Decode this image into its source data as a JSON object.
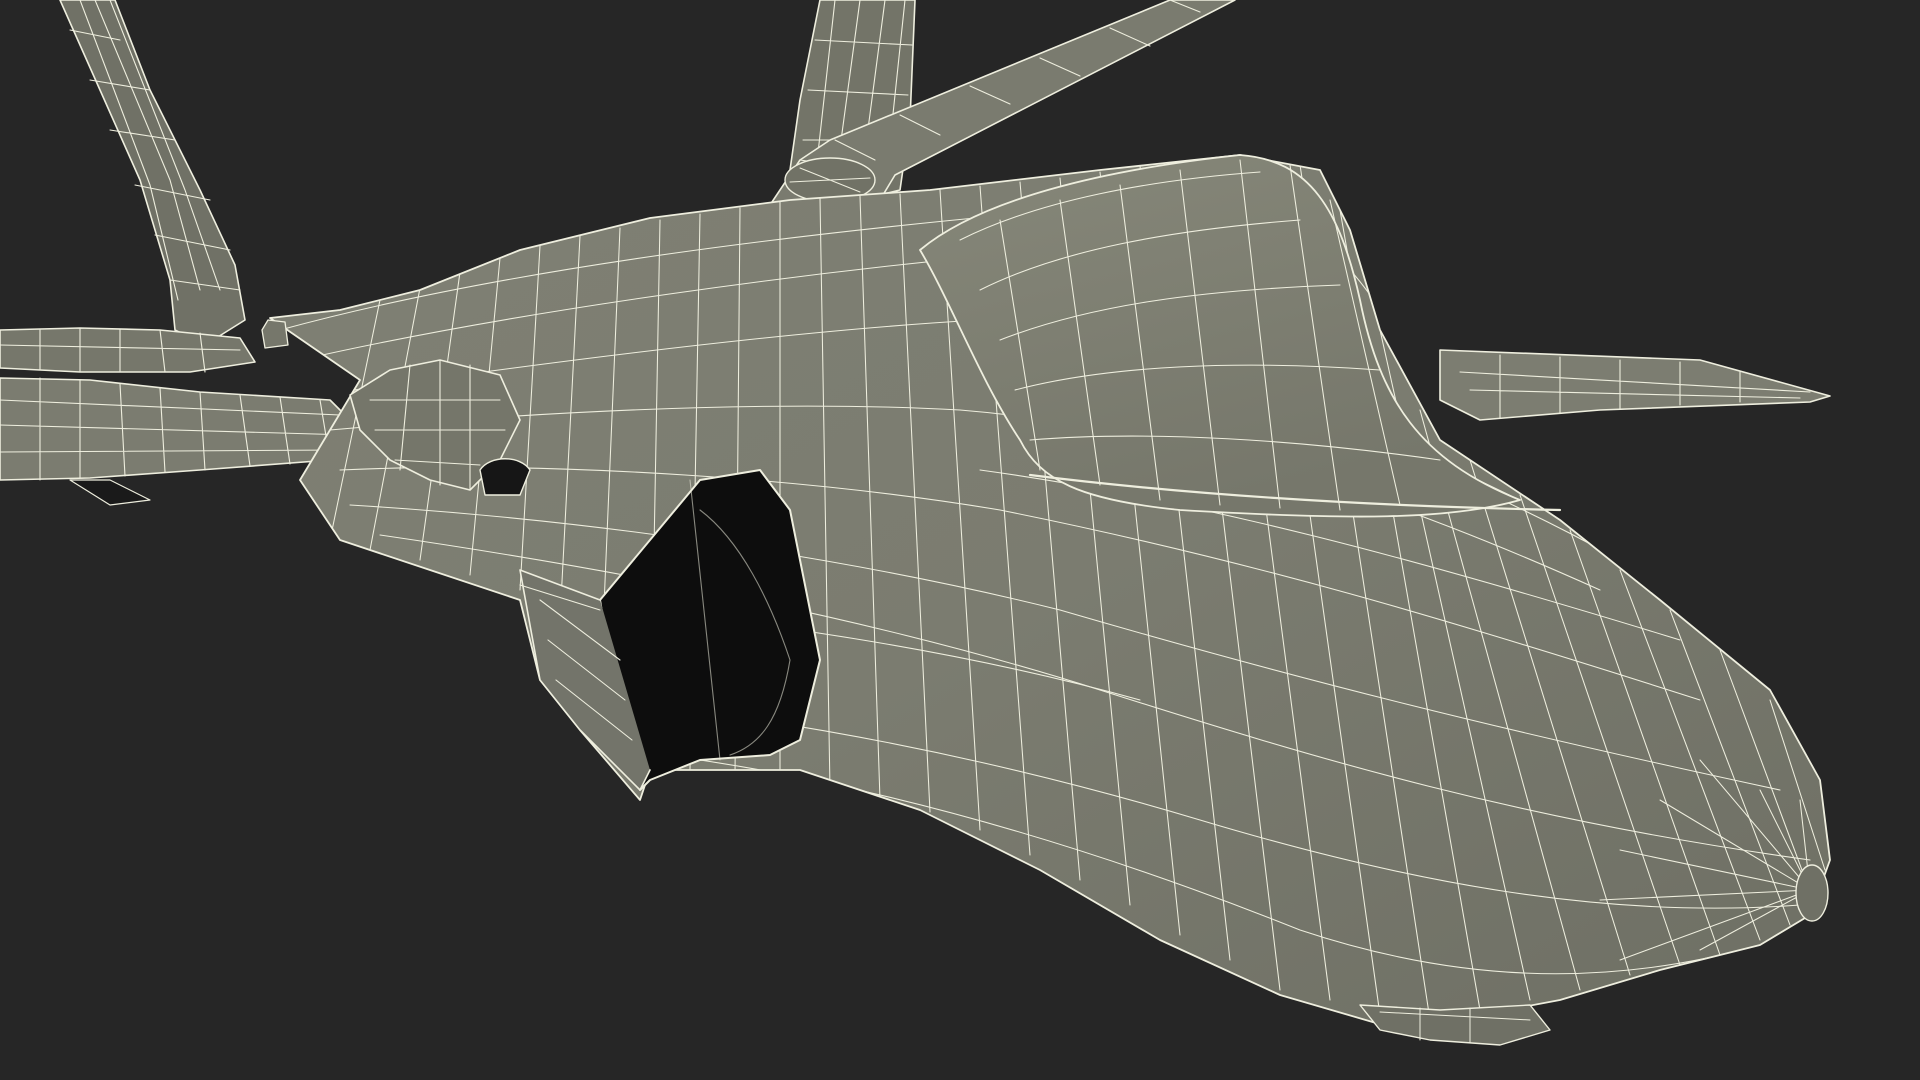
{
  "scene": {
    "subject": "jet-fighter-wireframe-render",
    "colors": {
      "background": "#262626",
      "surface": "#7b7c70",
      "surface_dark": "#5f6057",
      "surface_light": "#8a8b7f",
      "intake_interior": "#0d0d0d",
      "wire": "#eeeede"
    }
  }
}
